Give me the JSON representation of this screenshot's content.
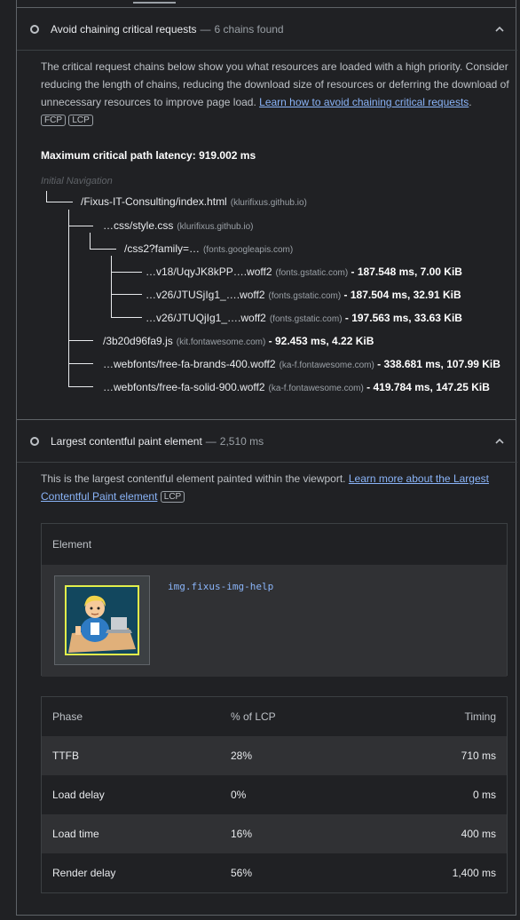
{
  "audit1": {
    "title": "Avoid chaining critical requests",
    "separator": "—",
    "subtitle": "6 chains found",
    "description_text": "The critical request chains below show you what resources are loaded with a high priority. Consider reducing the length of chains, reducing the download size of resources or deferring the download of unnecessary resources to improve page load. ",
    "learn_more": "Learn how to avoid chaining critical requests",
    "learn_more_suffix": ".",
    "badges": [
      "FCP",
      "LCP"
    ],
    "latency_label": "Maximum critical path latency: ",
    "latency_value": "919.002 ms",
    "initial_navigation": "Initial Navigation",
    "chain": [
      {
        "url": "/Fixus-IT-Consulting/index.html",
        "host": "(klurifixus.github.io)",
        "stat": ""
      },
      {
        "url": "…css/style.css",
        "host": "(klurifixus.github.io)",
        "stat": ""
      },
      {
        "url": "/css2?family=…",
        "host": "(fonts.googleapis.com)",
        "stat": ""
      },
      {
        "url": "…v18/UqyJK8kPP….woff2",
        "host": "(fonts.gstatic.com)",
        "stat": " - 187.548 ms, 7.00 KiB"
      },
      {
        "url": "…v26/JTUSjIg1_….woff2",
        "host": "(fonts.gstatic.com)",
        "stat": " - 187.504 ms, 32.91 KiB"
      },
      {
        "url": "…v26/JTUQjIg1_….woff2",
        "host": "(fonts.gstatic.com)",
        "stat": " - 197.563 ms, 33.63 KiB"
      },
      {
        "url": "/3b20d96fa9.js",
        "host": "(kit.fontawesome.com)",
        "stat": " - 92.453 ms, 4.22 KiB"
      },
      {
        "url": "…webfonts/free-fa-brands-400.woff2",
        "host": "(ka-f.fontawesome.com)",
        "stat": " - 338.681 ms, 107.99 KiB"
      },
      {
        "url": "…webfonts/free-fa-solid-900.woff2",
        "host": "(ka-f.fontawesome.com)",
        "stat": " - 419.784 ms, 147.25 KiB"
      }
    ]
  },
  "audit2": {
    "title": "Largest contentful paint element",
    "separator": "—",
    "subtitle": "2,510 ms",
    "description_text": "This is the largest contentful element painted within the viewport. ",
    "learn_more": "Learn more about the Largest Contentful Paint element",
    "badge": "LCP",
    "element_header": "Element",
    "element_selector": "img.fixus-img-help",
    "phase_headers": {
      "phase": "Phase",
      "pct": "% of LCP",
      "timing": "Timing"
    },
    "phases": [
      {
        "phase": "TTFB",
        "pct": "28%",
        "timing": "710 ms"
      },
      {
        "phase": "Load delay",
        "pct": "0%",
        "timing": "0 ms"
      },
      {
        "phase": "Load time",
        "pct": "16%",
        "timing": "400 ms"
      },
      {
        "phase": "Render delay",
        "pct": "56%",
        "timing": "1,400 ms"
      }
    ]
  }
}
